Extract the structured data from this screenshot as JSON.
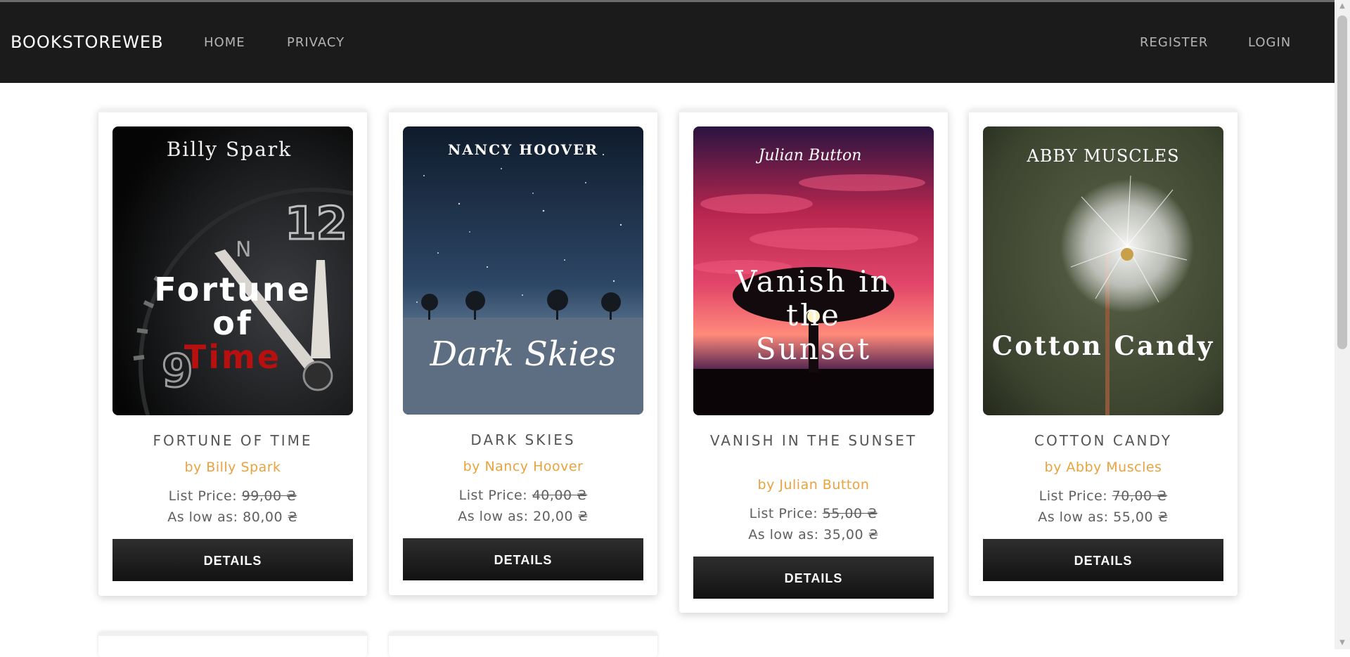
{
  "navbar": {
    "brand": "BOOKSTOREWEB",
    "links": [
      "HOME",
      "PRIVACY"
    ],
    "right_links": [
      "REGISTER",
      "LOGIN"
    ]
  },
  "books": [
    {
      "title": "FORTUNE OF TIME",
      "author": "by Billy Spark",
      "list_label": "List Price:",
      "list_price": "99,00 ₴",
      "low_label": "As low as:",
      "low_price": "80,00 ₴",
      "button": "DETAILS",
      "cover": {
        "author": "Billy Spark",
        "title_lines": [
          "Fortune",
          "of",
          "Time"
        ]
      }
    },
    {
      "title": "DARK SKIES",
      "author": "by Nancy Hoover",
      "list_label": "List Price:",
      "list_price": "40,00 ₴",
      "low_label": "As low as:",
      "low_price": "20,00 ₴",
      "button": "DETAILS",
      "cover": {
        "author": "NANCY HOOVER",
        "title": "Dark Skies"
      }
    },
    {
      "title": "VANISH IN THE SUNSET",
      "author": "by Julian Button",
      "list_label": "List Price:",
      "list_price": "55,00 ₴",
      "low_label": "As low as:",
      "low_price": "35,00 ₴",
      "button": "DETAILS",
      "cover": {
        "author": "Julian Button",
        "title_lines": [
          "Vanish in",
          "the",
          "Sunset"
        ]
      }
    },
    {
      "title": "COTTON CANDY",
      "author": "by Abby Muscles",
      "list_label": "List Price:",
      "list_price": "70,00 ₴",
      "low_label": "As low as:",
      "low_price": "55,00 ₴",
      "button": "DETAILS",
      "cover": {
        "author": "ABBY MUSCLES",
        "title": "Cotton Candy"
      }
    }
  ]
}
